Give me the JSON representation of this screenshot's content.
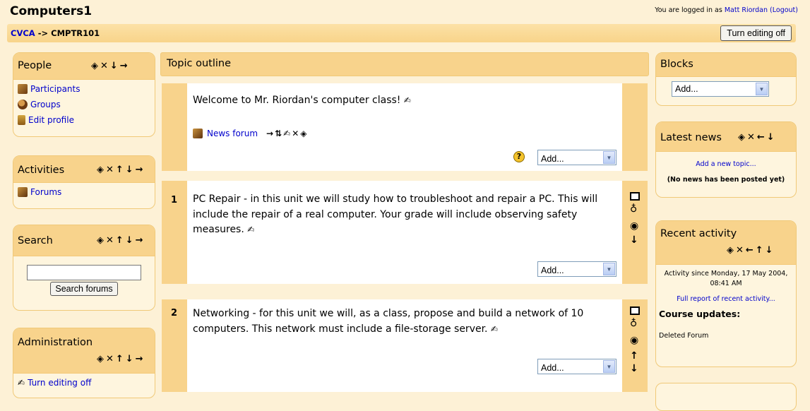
{
  "header": {
    "title": "Computers1",
    "login_prefix": "You are logged in as",
    "user": "Matt Riordan",
    "logout": "(Logout)"
  },
  "navbar": {
    "crumb_root": "CVCA",
    "crumb_sep": "->",
    "crumb_course": "CMPTR101",
    "edit_button": "Turn editing off"
  },
  "people": {
    "title": "People",
    "items": [
      "Participants",
      "Groups",
      "Edit profile"
    ]
  },
  "activities": {
    "title": "Activities",
    "items": [
      "Forums"
    ]
  },
  "search": {
    "title": "Search",
    "button": "Search forums"
  },
  "administration": {
    "title": "Administration",
    "items": [
      "Turn editing off"
    ]
  },
  "topic": {
    "title": "Topic outline",
    "intro": "Welcome to Mr. Riordan's computer class!",
    "news_link": "News forum",
    "add": "Add...",
    "sections": [
      {
        "num": "1",
        "text": "PC Repair - in this unit we will study how to troubleshoot and repair a PC. This will include the repair of a real computer. Your grade will include observing safety measures."
      },
      {
        "num": "2",
        "text": "Networking - for this unit we will, as a class, propose and build a network of 10 computers. This network must include a file-storage server."
      }
    ]
  },
  "blocks": {
    "title": "Blocks",
    "add": "Add..."
  },
  "news": {
    "title": "Latest news",
    "add_topic": "Add a new topic...",
    "empty": "(No news has been posted yet)"
  },
  "recent": {
    "title": "Recent activity",
    "since": "Activity since Monday, 17 May 2004, 08:41 AM",
    "full_report": "Full report of recent activity...",
    "updates": "Course updates:",
    "deleted": "Deleted Forum"
  },
  "icons": {
    "hide": "eye-icon",
    "delete": "cross-icon",
    "move": "arrow-icon",
    "edit": "quill-icon"
  }
}
